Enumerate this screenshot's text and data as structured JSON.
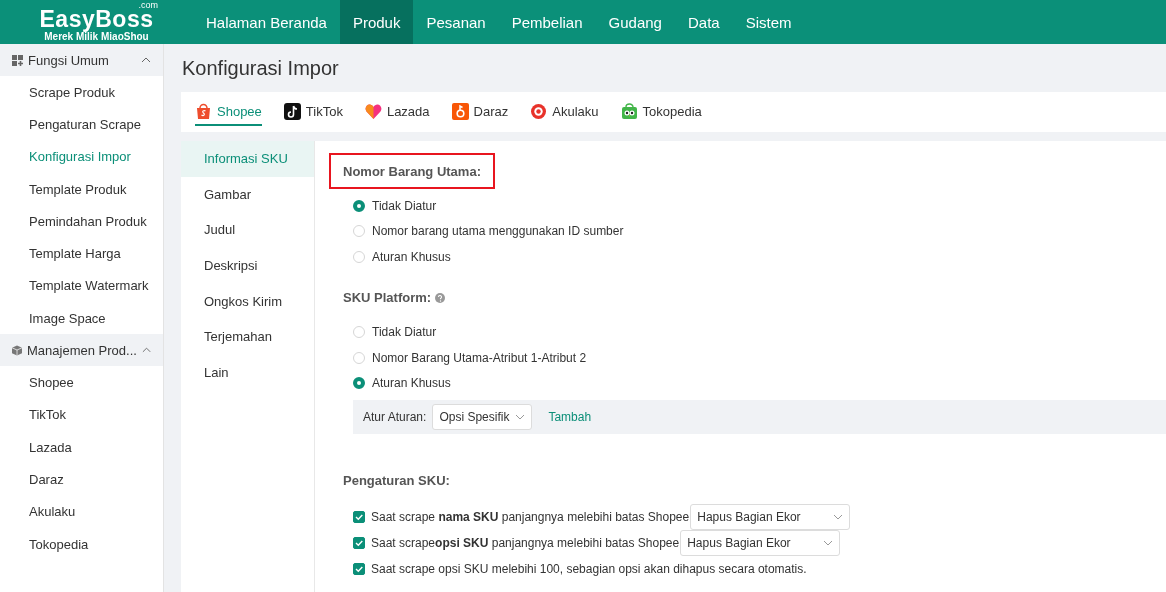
{
  "header": {
    "logo": {
      "brand": "EasyBoss",
      "suffix": ".com",
      "tagline": "Merek Milik MiaoShou"
    },
    "nav": [
      {
        "label": "Halaman Beranda",
        "selected": false
      },
      {
        "label": "Produk",
        "selected": true
      },
      {
        "label": "Pesanan",
        "selected": false
      },
      {
        "label": "Pembelian",
        "selected": false
      },
      {
        "label": "Gudang",
        "selected": false
      },
      {
        "label": "Data",
        "selected": false
      },
      {
        "label": "Sistem",
        "selected": false
      }
    ]
  },
  "sidebar": {
    "groups": [
      {
        "label": "Fungsi Umum",
        "kind": "grid",
        "expanded": true,
        "items": [
          {
            "label": "Scrape Produk",
            "selected": false
          },
          {
            "label": "Pengaturan Scrape",
            "selected": false
          },
          {
            "label": "Konfigurasi Impor",
            "selected": true
          },
          {
            "label": "Template Produk",
            "selected": false
          },
          {
            "label": "Pemindahan Produk",
            "selected": false
          },
          {
            "label": "Template Harga",
            "selected": false
          },
          {
            "label": "Template Watermark",
            "selected": false
          },
          {
            "label": "Image Space",
            "selected": false
          }
        ]
      },
      {
        "label": "Manajemen Prod...",
        "kind": "cube",
        "expanded": true,
        "items": [
          {
            "label": "Shopee",
            "selected": false
          },
          {
            "label": "TikTok",
            "selected": false
          },
          {
            "label": "Lazada",
            "selected": false
          },
          {
            "label": "Daraz",
            "selected": false
          },
          {
            "label": "Akulaku",
            "selected": false
          },
          {
            "label": "Tokopedia",
            "selected": false
          }
        ]
      }
    ]
  },
  "page_title": "Konfigurasi Impor",
  "platform_tabs": [
    {
      "label": "Shopee",
      "selected": true
    },
    {
      "label": "TikTok",
      "selected": false
    },
    {
      "label": "Lazada",
      "selected": false
    },
    {
      "label": "Daraz",
      "selected": false
    },
    {
      "label": "Akulaku",
      "selected": false
    },
    {
      "label": "Tokopedia",
      "selected": false
    }
  ],
  "settings_nav": [
    {
      "label": "Informasi SKU",
      "selected": true
    },
    {
      "label": "Gambar",
      "selected": false
    },
    {
      "label": "Judul",
      "selected": false
    },
    {
      "label": "Deskripsi",
      "selected": false
    },
    {
      "label": "Ongkos Kirim",
      "selected": false
    },
    {
      "label": "Terjemahan",
      "selected": false
    },
    {
      "label": "Lain",
      "selected": false
    }
  ],
  "sections": [
    {
      "kind": "radio",
      "title": "Nomor Barang Utama:",
      "highlighted": true,
      "help": false,
      "options": [
        {
          "label": "Tidak Diatur",
          "selected": true
        },
        {
          "label": "Nomor barang utama menggunakan ID sumber",
          "selected": false
        },
        {
          "label": "Aturan Khusus",
          "selected": false
        }
      ]
    },
    {
      "kind": "radio",
      "title": "SKU Platform:",
      "highlighted": false,
      "help": true,
      "options": [
        {
          "label": "Tidak Diatur",
          "selected": false
        },
        {
          "label": "Nomor Barang Utama-Atribut 1-Atribut 2",
          "selected": false
        },
        {
          "label": "Aturan Khusus",
          "selected": true
        }
      ],
      "rule": {
        "label": "Atur Aturan:",
        "select": "Opsi Spesifik",
        "link": "Tambah"
      }
    },
    {
      "kind": "checkbox",
      "title": "Pengaturan SKU:",
      "highlighted": false,
      "help": false,
      "checks": [
        {
          "text": "Saat scrape **nama SKU** panjangnya melebihi batas Shopee",
          "checked": true,
          "select": "Hapus Bagian Ekor"
        },
        {
          "text": "Saat scrape**opsi SKU** panjangnya melebihi batas Shopee",
          "checked": true,
          "select": "Hapus Bagian Ekor"
        },
        {
          "text": "Saat scrape opsi SKU melebihi 100, sebagian opsi akan dihapus secara otomatis.",
          "checked": true
        }
      ]
    }
  ]
}
